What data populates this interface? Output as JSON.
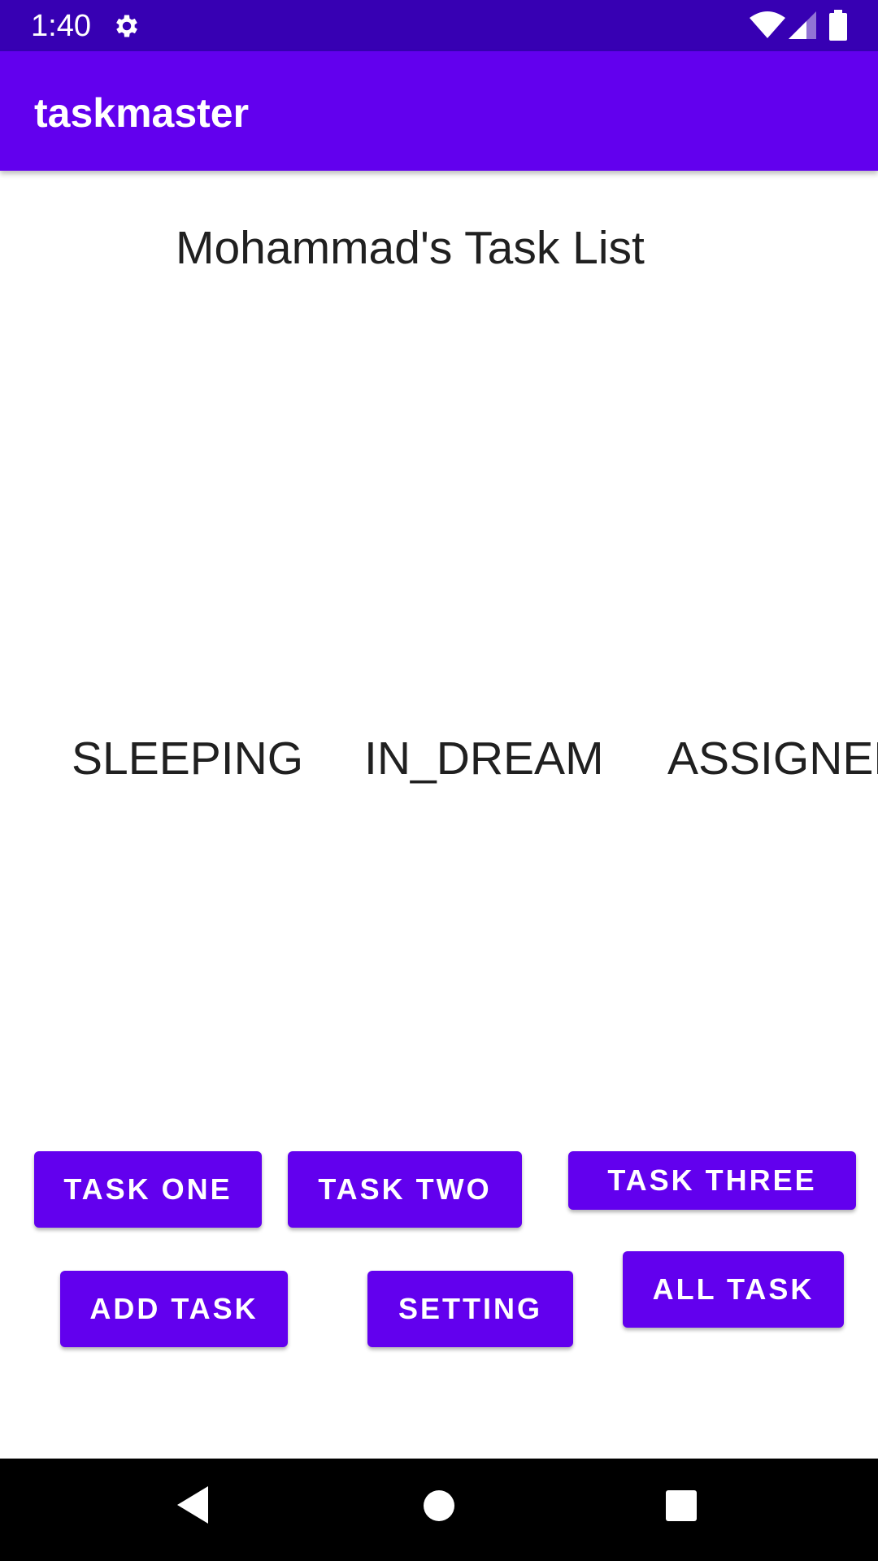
{
  "status_bar": {
    "time": "1:40",
    "background_color": "#3700b3",
    "icons": [
      "gear-icon",
      "wifi-icon",
      "signal-icon",
      "battery-icon"
    ]
  },
  "app_bar": {
    "title": "taskmaster",
    "background_color": "#6200ee"
  },
  "main": {
    "heading": "Mohammad's Task List",
    "status_labels": [
      "SLEEPING",
      "IN_DREAM",
      "ASSIGNED"
    ]
  },
  "buttons": {
    "task_one": "TASK ONE",
    "task_two": "TASK TWO",
    "task_three": "TASK THREE",
    "add_task": "ADD TASK",
    "setting": "SETTING",
    "all_task": "ALL TASK",
    "color": "#6200ee"
  },
  "nav_bar": {
    "icons": [
      "back-icon",
      "home-icon",
      "recents-icon"
    ]
  }
}
